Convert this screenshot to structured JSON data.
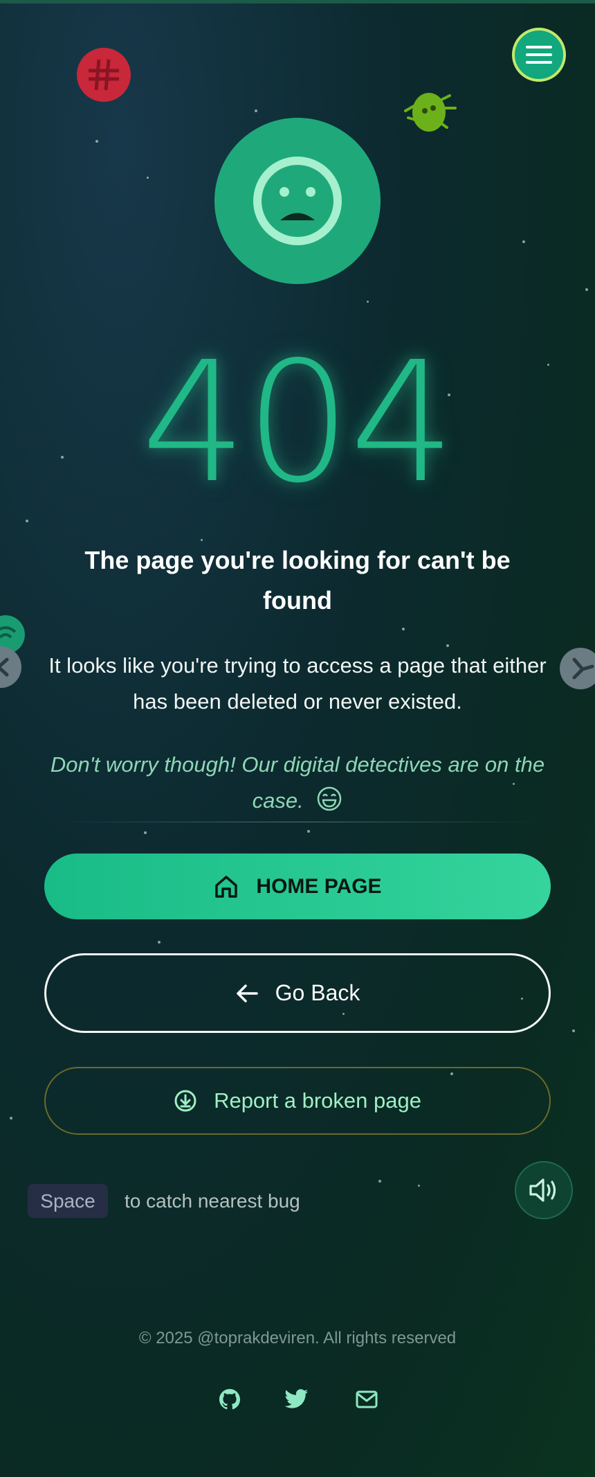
{
  "error": {
    "code": "404",
    "headline": "The page you're looking for can't be found",
    "description": "It looks like you're trying to access a page that either has been deleted or never existed.",
    "reassurance": "Don't worry though! Our digital detectives are on the case."
  },
  "actions": {
    "home_label": "HOME PAGE",
    "back_label": "Go Back",
    "report_label": "Report a broken page"
  },
  "hint": {
    "key": "Space",
    "text": "to catch nearest bug"
  },
  "footer": {
    "copyright": "© 2025 @toprakdeviren. All rights reserved"
  },
  "icons": {
    "menu": "hamburger-menu-icon",
    "sad_face": "sad-face-icon",
    "home": "home-icon",
    "back": "arrow-left-icon",
    "report": "download-circle-icon",
    "sound": "speaker-volume-icon",
    "github": "github-icon",
    "twitter": "twitter-icon",
    "mail": "mail-icon",
    "grin": "grinning-face-icon"
  },
  "colors": {
    "accent": "#20b886",
    "accent_light": "#35d49d",
    "menu_border": "#c3e86c",
    "report_border": "#6b6a2a"
  }
}
